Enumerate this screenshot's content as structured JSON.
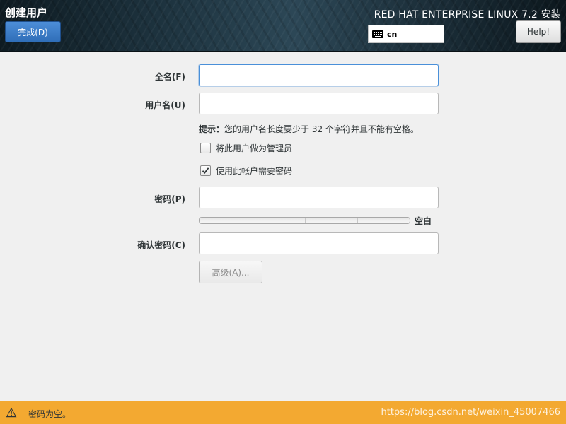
{
  "header": {
    "title": "创建用户",
    "done_label": "完成(D)",
    "product_title": "RED HAT ENTERPRISE LINUX 7.2 安装",
    "keyboard_layout": "cn",
    "help_label": "Help!"
  },
  "form": {
    "fullname": {
      "label": "全名(F)",
      "value": ""
    },
    "username": {
      "label": "用户名(U)",
      "value": ""
    },
    "hint_prefix": "提示：",
    "hint_text": "您的用户名长度要少于 32 个字符并且不能有空格。",
    "admin_checkbox": {
      "label": "将此用户做为管理员",
      "checked": false
    },
    "require_password_checkbox": {
      "label": "使用此帐户需要密码",
      "checked": true
    },
    "password": {
      "label": "密码(P)",
      "value": ""
    },
    "password_strength": {
      "value": 0,
      "text": "空白"
    },
    "confirm_password": {
      "label": "确认密码(C)",
      "value": ""
    },
    "advanced_label": "高级(A)..."
  },
  "status_bar": {
    "message": "密码为空。",
    "watermark": "https://blog.csdn.net/weixin_45007466"
  },
  "colors": {
    "accent": "#4a90d9",
    "done_button": "#2f6eb8",
    "warning_bar": "#f3a931"
  },
  "icons": {
    "keyboard": "keyboard-icon",
    "warning": "warning-icon",
    "check": "checkmark-icon"
  }
}
